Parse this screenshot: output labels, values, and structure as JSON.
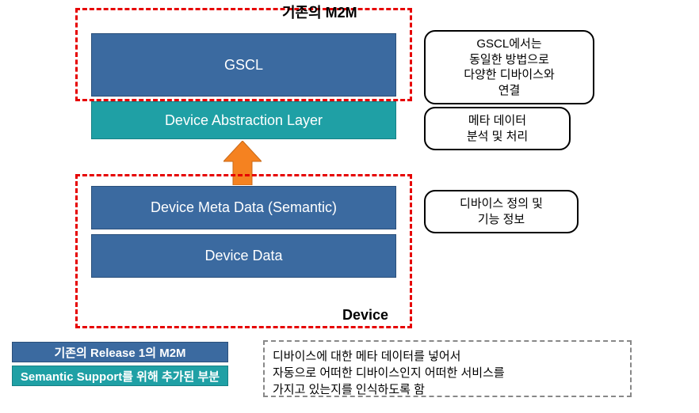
{
  "sections": {
    "m2m_label": "기존의 M2M",
    "device_label": "Device"
  },
  "blocks": {
    "gscl": "GSCL",
    "dal": "Device Abstraction Layer",
    "meta": "Device Meta Data (Semantic)",
    "data": "Device Data"
  },
  "callouts": {
    "gscl_note": "GSCL에서는\n동일한 방법으로\n다양한 디바이스와\n연결",
    "dal_note": "메타 데이터\n분석 및 처리",
    "meta_note": "디바이스 정의 및\n기능 정보"
  },
  "legend": {
    "release1": "기존의 Release 1의 M2M",
    "semantic": "Semantic Support를 위해 추가된 부분"
  },
  "note": "디바이스에 대한 메타 데이터를 넣어서\n자동으로 어떠한 디바이스인지 어떠한 서비스를\n가지고 있는지를 인식하도록 함",
  "colors": {
    "release1_bg": "#3b6aa0",
    "semantic_bg": "#1fa0a5",
    "dashed_border": "#e60000",
    "arrow_fill": "#f58220"
  }
}
